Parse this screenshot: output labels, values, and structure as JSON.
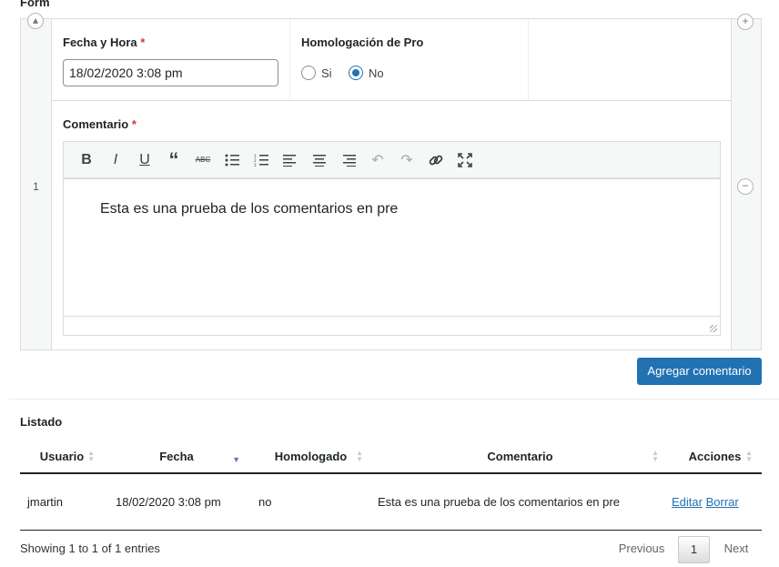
{
  "form": {
    "title": "Form",
    "row_number": "1",
    "fecha_label": "Fecha y Hora",
    "fecha_value": "18/02/2020 3:08 pm",
    "homologacion_label": "Homologación de Pro",
    "radio_si": "Si",
    "radio_no": "No",
    "radio_selected": "No",
    "comentario_label": "Comentario",
    "required_mark": "*",
    "editor_content": "Esta es una prueba de los comentarios en pre",
    "toolbar": [
      "bold-icon",
      "italic-icon",
      "underline-icon",
      "blockquote-icon",
      "strikethrough-icon",
      "bullet-list-icon",
      "numbered-list-icon",
      "align-left-icon",
      "align-center-icon",
      "align-right-icon",
      "undo-icon",
      "redo-icon",
      "link-icon",
      "fullscreen-icon"
    ],
    "submit_label": "Agregar comentario",
    "accent_color": "#2271b1"
  },
  "listado": {
    "title": "Listado",
    "columns": [
      "Usuario",
      "Fecha",
      "Homologado",
      "Comentario",
      "Acciones"
    ],
    "rows": [
      {
        "usuario": "jmartin",
        "fecha": "18/02/2020 3:08 pm",
        "homologado": "no",
        "comentario": "Esta es una prueba de los comentarios en pre",
        "edit": "Editar",
        "delete": "Borrar"
      }
    ],
    "info": "Showing 1 to 1 of 1 entries",
    "pagination": {
      "previous": "Previous",
      "current": "1",
      "next": "Next"
    }
  }
}
